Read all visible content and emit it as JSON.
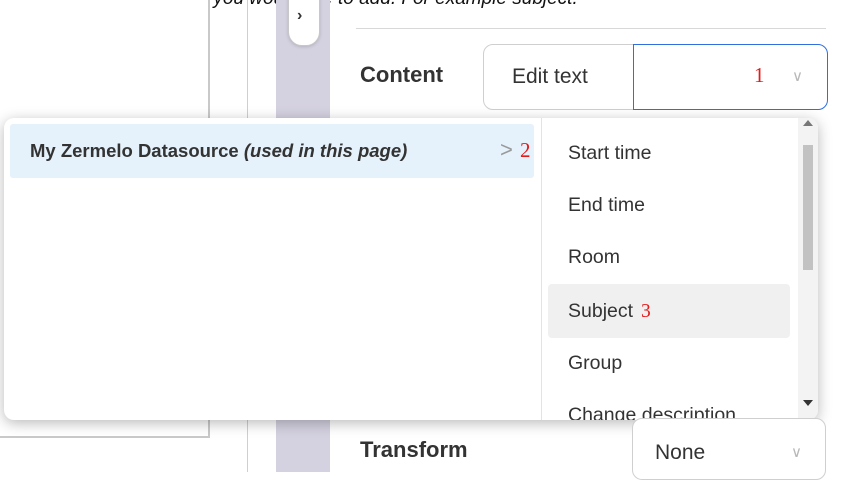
{
  "instruction": {
    "text": "datasource, and the field you would like to add. For example subject."
  },
  "sidebar_toggle": {
    "glyph": "›",
    "icon": "chevron-right-icon"
  },
  "content_row": {
    "label": "Content",
    "mode_value": "Edit text",
    "field_value": "",
    "annotation": "1",
    "chevron": "∨"
  },
  "datasource_menu": {
    "datasource_name": "My Zermelo Datasource",
    "datasource_note": "(used in this page)",
    "arrow": ">",
    "annotation": "2"
  },
  "field_menu": {
    "items": [
      {
        "label": "Start time",
        "annotation": ""
      },
      {
        "label": "End time",
        "annotation": ""
      },
      {
        "label": "Room",
        "annotation": ""
      },
      {
        "label": "Subject",
        "annotation": "3"
      },
      {
        "label": "Group",
        "annotation": ""
      },
      {
        "label": "Change description",
        "annotation": ""
      }
    ],
    "highlighted_index": 3
  },
  "transform_row": {
    "label": "Transform",
    "value": "None",
    "chevron": "∨"
  },
  "colors": {
    "annotation_red": "#e41b1b",
    "focus_blue": "#2f6fe0",
    "selected_row_bg": "#e5f1fb",
    "rail": "#d4d1e0"
  }
}
